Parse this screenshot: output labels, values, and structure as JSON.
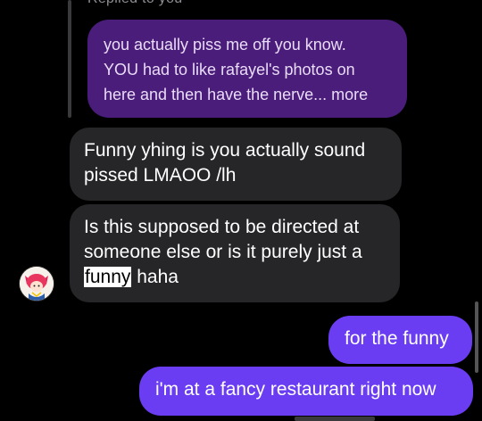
{
  "reply_header": {
    "label": "Replied to you"
  },
  "quoted_message": {
    "lines": [
      "you actually piss me off you know.",
      "YOU had to like rafayel's photos on",
      "here and then have the nerve... more"
    ]
  },
  "incoming": [
    {
      "lines": [
        "Funny yhing is you actually sound",
        "pissed LMAOO /lh"
      ]
    },
    {
      "line1": "Is this supposed to be directed at",
      "line2": "someone else or is it purely just a",
      "highlight": "funny",
      "tail": " haha"
    }
  ],
  "outgoing": [
    {
      "text": "for the funny"
    },
    {
      "text": "i'm at a fancy restaurant right now"
    }
  ],
  "avatar": {
    "icon": "anime-character-avatar-icon"
  },
  "colors": {
    "background": "#000000",
    "incoming_bubble": "#262629",
    "outgoing_bubble": "#6a3df2",
    "quoted_bubble": "#4a1d7a"
  }
}
